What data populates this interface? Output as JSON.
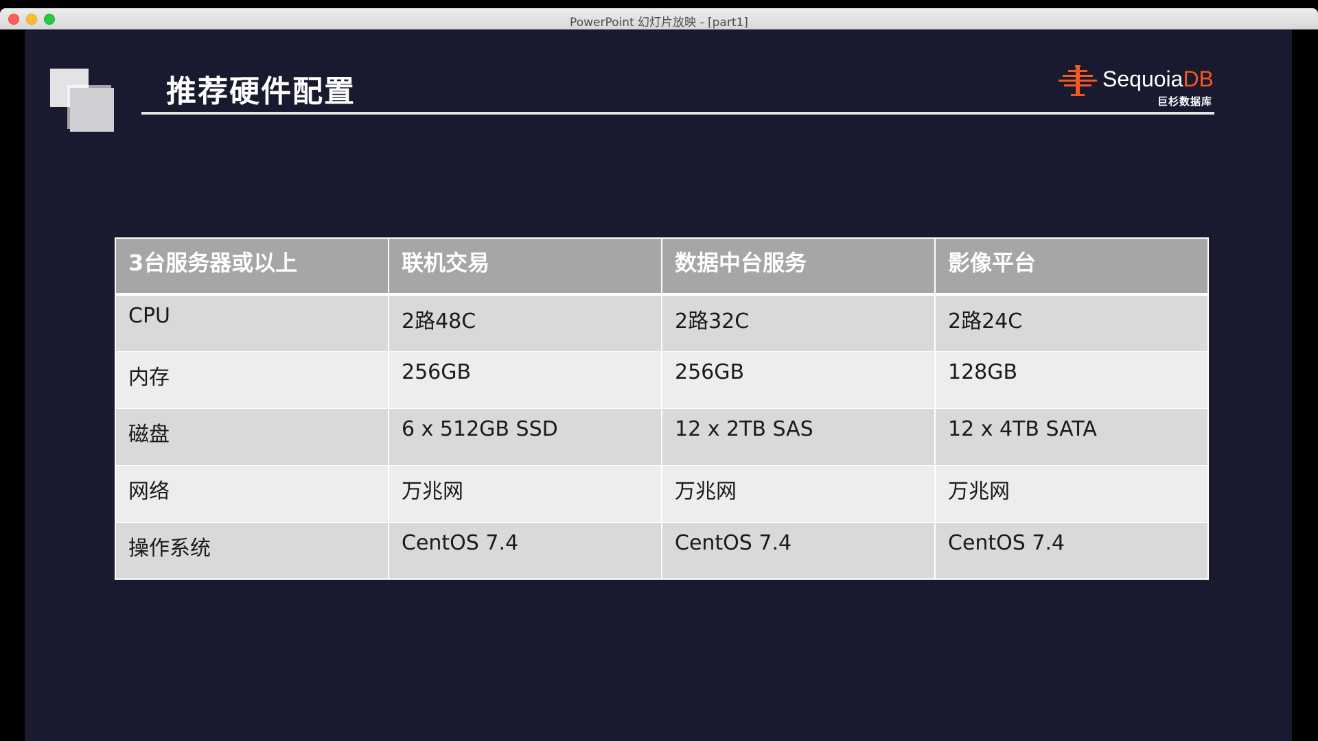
{
  "window": {
    "title": "PowerPoint 幻灯片放映 - [part1]"
  },
  "slide": {
    "title": "推荐硬件配置",
    "logo": {
      "name_main": "Sequoia",
      "name_accent": "DB",
      "name_cn": "巨杉数据库",
      "accent_color": "#f25a1f"
    },
    "table": {
      "headers": [
        "3台服务器或以上",
        "联机交易",
        "数据中台服务",
        "影像平台"
      ],
      "rows": [
        [
          "CPU",
          "2路48C",
          "2路32C",
          "2路24C"
        ],
        [
          "内存",
          "256GB",
          "256GB",
          "128GB"
        ],
        [
          "磁盘",
          "6 x 512GB SSD",
          "12 x 2TB SAS",
          "12 x 4TB SATA"
        ],
        [
          "网络",
          "万兆网",
          "万兆网",
          "万兆网"
        ],
        [
          "操作系统",
          "CentOS 7.4",
          "CentOS 7.4",
          "CentOS 7.4"
        ]
      ]
    }
  }
}
